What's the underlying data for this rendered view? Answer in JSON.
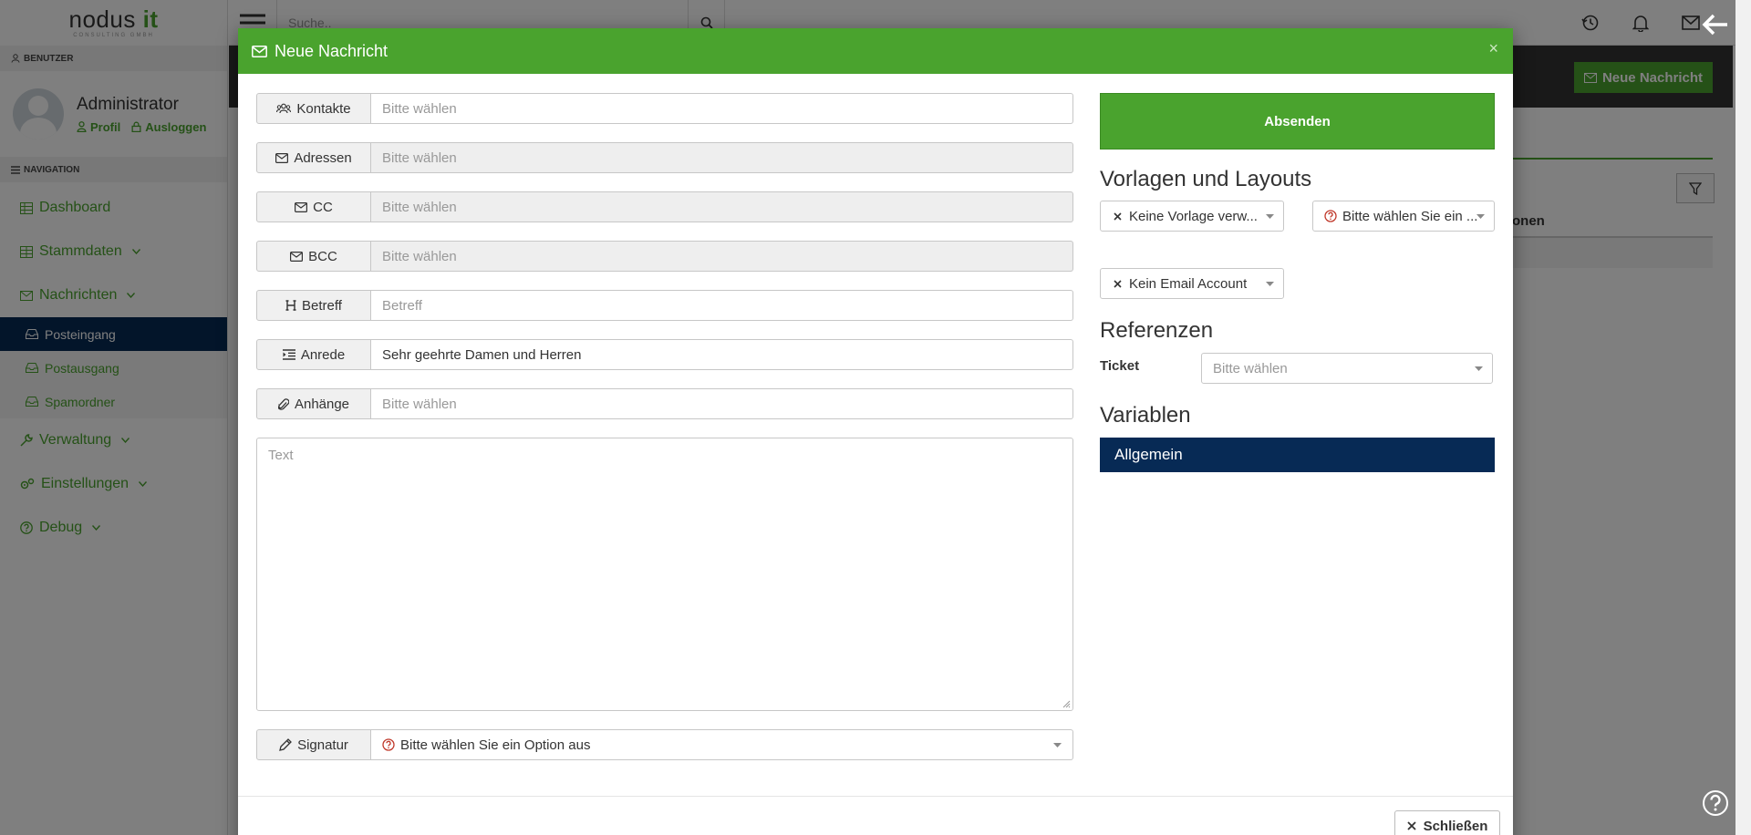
{
  "app": {
    "logo_main": "nodus",
    "logo_accent": "it",
    "logo_sub": "CONSULTING GMBH"
  },
  "sidebar": {
    "user_section": "BENUTZER",
    "user_name": "Administrator",
    "profile_link": "Profil",
    "logout_link": "Ausloggen",
    "nav_section": "NAVIGATION",
    "items": [
      {
        "label": "Dashboard"
      },
      {
        "label": "Stammdaten"
      },
      {
        "label": "Nachrichten"
      },
      {
        "label": "Posteingang"
      },
      {
        "label": "Postausgang"
      },
      {
        "label": "Spamordner"
      },
      {
        "label": "Verwaltung"
      },
      {
        "label": "Einstellungen"
      },
      {
        "label": "Debug"
      }
    ]
  },
  "topbar": {
    "search_placeholder": "Suche.."
  },
  "background": {
    "new_message_button": "Neue Nachricht",
    "column_header": "onen"
  },
  "modal": {
    "title": "Neue Nachricht",
    "close_x": "×",
    "fields": {
      "kontakte": {
        "label": "Kontakte",
        "value": "Bitte wählen"
      },
      "adressen": {
        "label": "Adressen",
        "value": "Bitte wählen"
      },
      "cc": {
        "label": "CC",
        "value": "Bitte wählen"
      },
      "bcc": {
        "label": "BCC",
        "value": "Bitte wählen"
      },
      "betreff": {
        "label": "Betreff",
        "value": "Betreff"
      },
      "anrede": {
        "label": "Anrede",
        "value": "Sehr geehrte Damen und Herren"
      },
      "anhaenge": {
        "label": "Anhänge",
        "value": "Bitte wählen"
      },
      "signatur": {
        "label": "Signatur",
        "value": "Bitte wählen Sie ein Option aus"
      }
    },
    "text_placeholder": "Text",
    "send_button": "Absenden",
    "templates_title": "Vorlagen und Layouts",
    "template_select": "Keine Vorlage verw...",
    "layout_select": "Bitte wählen Sie ein ...",
    "email_account_select": "Kein Email Account",
    "references_title": "Referenzen",
    "ticket_label": "Ticket",
    "ticket_value": "Bitte wählen",
    "variables_title": "Variablen",
    "variables_group": "Allgemein",
    "close_button": "Schließen"
  },
  "colors": {
    "brand_green": "#4aa32e",
    "navy": "#072a55",
    "question_red": "#c0392b"
  }
}
